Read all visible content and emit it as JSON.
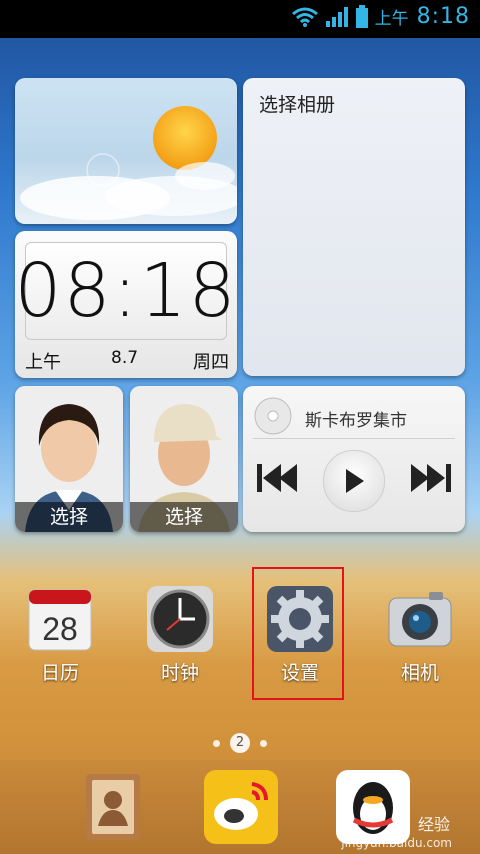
{
  "status_bar": {
    "ampm": "上午",
    "time": "8:18"
  },
  "album_widget": {
    "title": "选择相册"
  },
  "clock_widget": {
    "time": "08:18",
    "ampm": "上午",
    "date": "8.7",
    "weekday": "周四"
  },
  "contacts": [
    {
      "label": "选择"
    },
    {
      "label": "选择"
    }
  ],
  "music_widget": {
    "title": "斯卡布罗集市"
  },
  "apps": [
    {
      "label": "日历",
      "icon": "calendar-icon",
      "day": "28"
    },
    {
      "label": "时钟",
      "icon": "clock-icon"
    },
    {
      "label": "设置",
      "icon": "gear-icon"
    },
    {
      "label": "相机",
      "icon": "camera-icon"
    }
  ],
  "page_indicator": {
    "current": "2"
  },
  "dock": [
    {
      "icon": "contacts-book-icon"
    },
    {
      "icon": "weibo-icon"
    },
    {
      "icon": "qq-penguin-icon"
    }
  ],
  "watermark": {
    "text": "经验",
    "sub": "jingyan.baidu.com"
  },
  "colors": {
    "highlight": "#e4131b",
    "status_accent": "#33b5e5"
  }
}
